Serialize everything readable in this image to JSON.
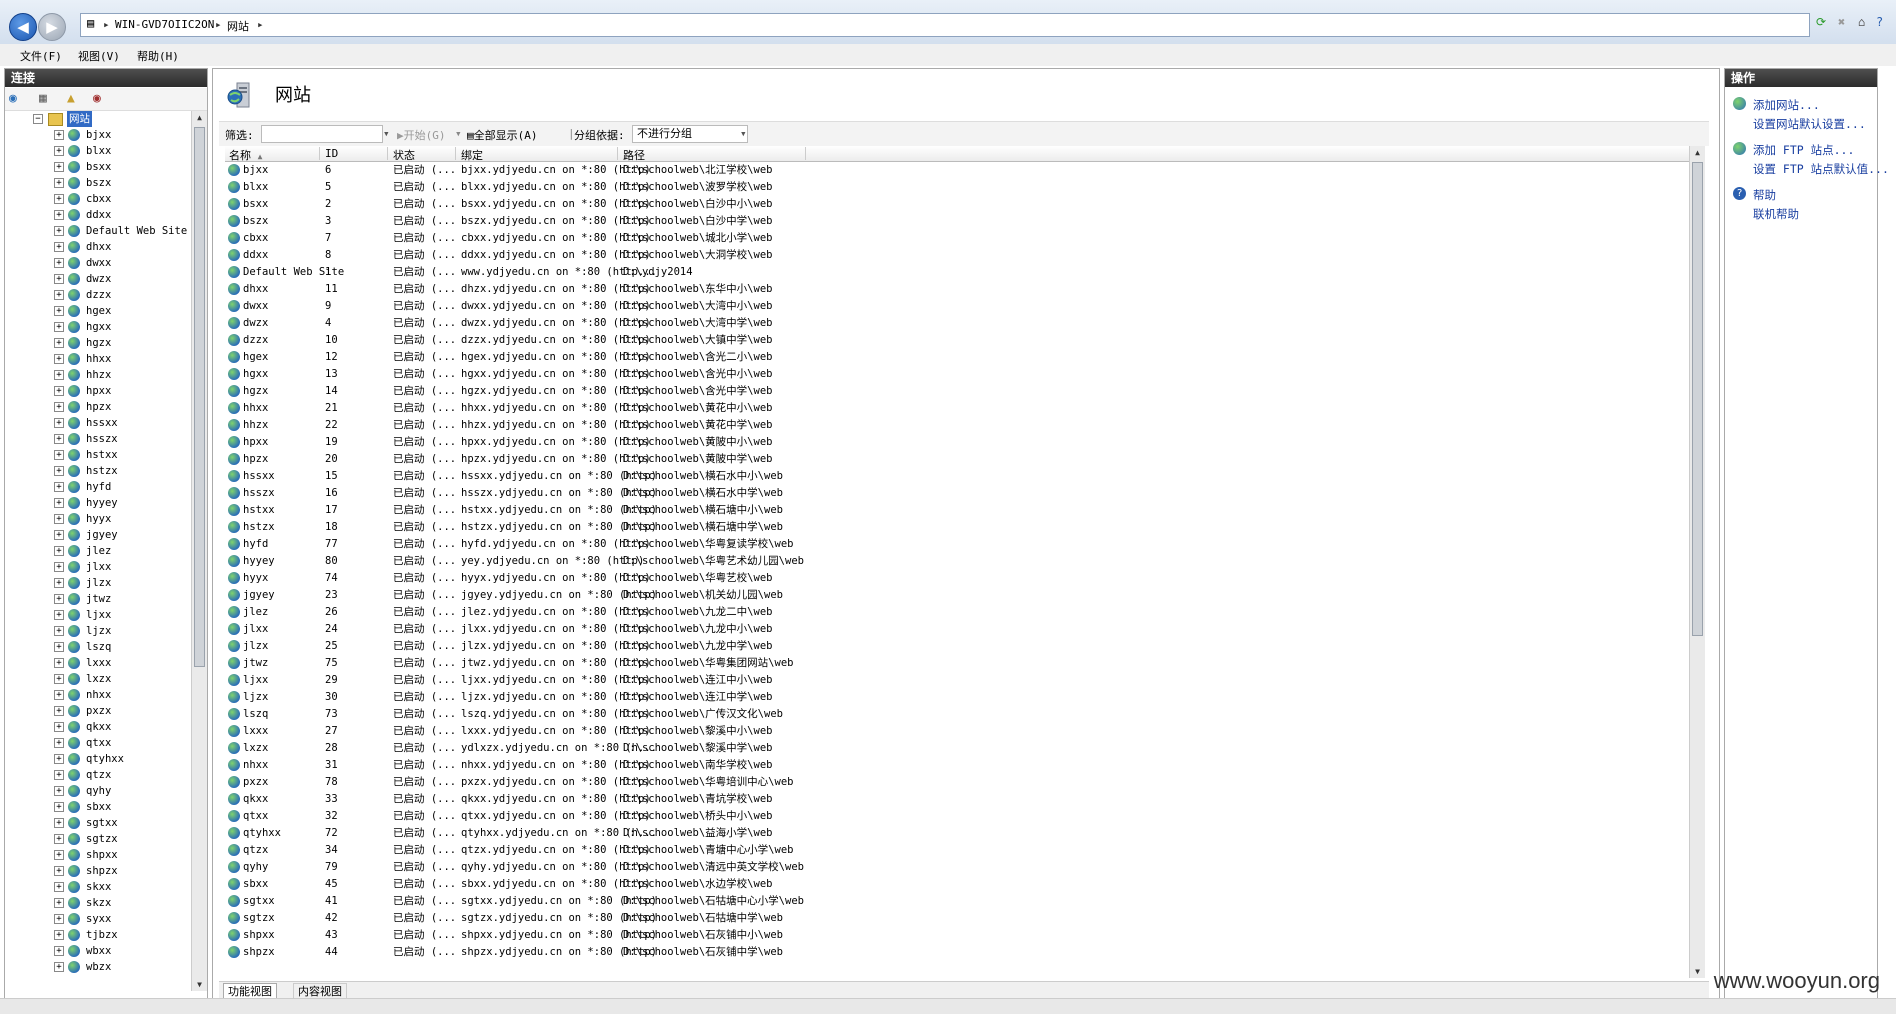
{
  "address": {
    "server": "WIN-GVD7OIIC2ON",
    "page": "网站"
  },
  "menu": [
    "文件(F)",
    "视图(V)",
    "帮助(H)"
  ],
  "connections": {
    "title": "连接",
    "root": "网站",
    "sites": [
      "bjxx",
      "blxx",
      "bsxx",
      "bszx",
      "cbxx",
      "ddxx",
      "Default Web Site",
      "dhxx",
      "dwxx",
      "dwzx",
      "dzzx",
      "hgex",
      "hgxx",
      "hgzx",
      "hhxx",
      "hhzx",
      "hpxx",
      "hpzx",
      "hssxx",
      "hsszx",
      "hstxx",
      "hstzx",
      "hyfd",
      "hyyey",
      "hyyx",
      "jgyey",
      "jlez",
      "jlxx",
      "jlzx",
      "jtwz",
      "ljxx",
      "ljzx",
      "lszq",
      "lxxx",
      "lxzx",
      "nhxx",
      "pxzx",
      "qkxx",
      "qtxx",
      "qtyhxx",
      "qtzx",
      "qyhy",
      "sbxx",
      "sgtxx",
      "sgtzx",
      "shpxx",
      "shpzx",
      "skxx",
      "skzx",
      "syxx",
      "tjbzx",
      "wbxx",
      "wbzx"
    ]
  },
  "main": {
    "title": "网站",
    "filter_label": "筛选:",
    "start_button": "开始(G)",
    "show_all_button": "全部显示(A)",
    "group_label": "分组依据:",
    "group_value": "不进行分组",
    "columns": [
      "名称",
      "ID",
      "状态",
      "绑定",
      "路径"
    ],
    "rows": [
      [
        "bjxx",
        "6",
        "已启动 (...",
        "bjxx.ydjyedu.cn on *:80 (http)",
        "D:\\schoolweb\\北江学校\\web"
      ],
      [
        "blxx",
        "5",
        "已启动 (...",
        "blxx.ydjyedu.cn on *:80 (http)",
        "D:\\schoolweb\\波罗学校\\web"
      ],
      [
        "bsxx",
        "2",
        "已启动 (...",
        "bsxx.ydjyedu.cn on *:80 (http)",
        "D:\\schoolweb\\白沙中小\\web"
      ],
      [
        "bszx",
        "3",
        "已启动 (...",
        "bszx.ydjyedu.cn on *:80 (http)",
        "D:\\schoolweb\\白沙中学\\web"
      ],
      [
        "cbxx",
        "7",
        "已启动 (...",
        "cbxx.ydjyedu.cn on *:80 (http)",
        "D:\\schoolweb\\城北小学\\web"
      ],
      [
        "ddxx",
        "8",
        "已启动 (...",
        "ddxx.ydjyedu.cn on *:80 (http)",
        "D:\\schoolweb\\大洞学校\\web"
      ],
      [
        "Default Web Site",
        "1",
        "已启动 (...",
        "www.ydjyedu.cn on *:80 (http...",
        "D:\\ydjy2014"
      ],
      [
        "dhxx",
        "11",
        "已启动 (...",
        "dhzx.ydjyedu.cn on *:80 (http)",
        "D:\\schoolweb\\东华中小\\web"
      ],
      [
        "dwxx",
        "9",
        "已启动 (...",
        "dwxx.ydjyedu.cn on *:80 (http)",
        "D:\\schoolweb\\大湾中小\\web"
      ],
      [
        "dwzx",
        "4",
        "已启动 (...",
        "dwzx.ydjyedu.cn on *:80 (http)",
        "D:\\schoolweb\\大湾中学\\web"
      ],
      [
        "dzzx",
        "10",
        "已启动 (...",
        "dzzx.ydjyedu.cn on *:80 (http)",
        "D:\\schoolweb\\大镇中学\\web"
      ],
      [
        "hgex",
        "12",
        "已启动 (...",
        "hgex.ydjyedu.cn on *:80 (http)",
        "D:\\schoolweb\\含光二小\\web"
      ],
      [
        "hgxx",
        "13",
        "已启动 (...",
        "hgxx.ydjyedu.cn on *:80 (http)",
        "D:\\schoolweb\\含光中小\\web"
      ],
      [
        "hgzx",
        "14",
        "已启动 (...",
        "hgzx.ydjyedu.cn on *:80 (http)",
        "D:\\schoolweb\\含光中学\\web"
      ],
      [
        "hhxx",
        "21",
        "已启动 (...",
        "hhxx.ydjyedu.cn on *:80 (http)",
        "D:\\schoolweb\\黄花中小\\web"
      ],
      [
        "hhzx",
        "22",
        "已启动 (...",
        "hhzx.ydjyedu.cn on *:80 (http)",
        "D:\\schoolweb\\黄花中学\\web"
      ],
      [
        "hpxx",
        "19",
        "已启动 (...",
        "hpxx.ydjyedu.cn on *:80 (http)",
        "D:\\schoolweb\\黄陂中小\\web"
      ],
      [
        "hpzx",
        "20",
        "已启动 (...",
        "hpzx.ydjyedu.cn on *:80 (http)",
        "D:\\schoolweb\\黄陂中学\\web"
      ],
      [
        "hssxx",
        "15",
        "已启动 (...",
        "hssxx.ydjyedu.cn on *:80 (http)",
        "D:\\schoolweb\\横石水中小\\web"
      ],
      [
        "hsszx",
        "16",
        "已启动 (...",
        "hsszx.ydjyedu.cn on *:80 (http)",
        "D:\\schoolweb\\横石水中学\\web"
      ],
      [
        "hstxx",
        "17",
        "已启动 (...",
        "hstxx.ydjyedu.cn on *:80 (http)",
        "D:\\schoolweb\\横石塘中小\\web"
      ],
      [
        "hstzx",
        "18",
        "已启动 (...",
        "hstzx.ydjyedu.cn on *:80 (http)",
        "D:\\schoolweb\\横石塘中学\\web"
      ],
      [
        "hyfd",
        "77",
        "已启动 (...",
        "hyfd.ydjyedu.cn on *:80 (http)",
        "D:\\schoolweb\\华粤复读学校\\web"
      ],
      [
        "hyyey",
        "80",
        "已启动 (...",
        "yey.ydjyedu.cn on *:80 (http)",
        "D:\\schoolweb\\华粤艺术幼儿园\\web"
      ],
      [
        "hyyx",
        "74",
        "已启动 (...",
        "hyyx.ydjyedu.cn on *:80 (http)",
        "D:\\schoolweb\\华粤艺校\\web"
      ],
      [
        "jgyey",
        "23",
        "已启动 (...",
        "jgyey.ydjyedu.cn on *:80 (http)",
        "D:\\schoolweb\\机关幼儿园\\web"
      ],
      [
        "jlez",
        "26",
        "已启动 (...",
        "jlez.ydjyedu.cn on *:80 (http)",
        "D:\\schoolweb\\九龙二中\\web"
      ],
      [
        "jlxx",
        "24",
        "已启动 (...",
        "jlxx.ydjyedu.cn on *:80 (http)",
        "D:\\schoolweb\\九龙中小\\web"
      ],
      [
        "jlzx",
        "25",
        "已启动 (...",
        "jlzx.ydjyedu.cn on *:80 (http)",
        "D:\\schoolweb\\九龙中学\\web"
      ],
      [
        "jtwz",
        "75",
        "已启动 (...",
        "jtwz.ydjyedu.cn on *:80 (http)",
        "D:\\schoolweb\\华粤集团网站\\web"
      ],
      [
        "ljxx",
        "29",
        "已启动 (...",
        "ljxx.ydjyedu.cn on *:80 (http)",
        "D:\\schoolweb\\连江中小\\web"
      ],
      [
        "ljzx",
        "30",
        "已启动 (...",
        "ljzx.ydjyedu.cn on *:80 (http)",
        "D:\\schoolweb\\连江中学\\web"
      ],
      [
        "lszq",
        "73",
        "已启动 (...",
        "lszq.ydjyedu.cn on *:80 (http)",
        "D:\\schoolweb\\广传汉文化\\web"
      ],
      [
        "lxxx",
        "27",
        "已启动 (...",
        "lxxx.ydjyedu.cn on *:80 (http)",
        "D:\\schoolweb\\黎溪中小\\web"
      ],
      [
        "lxzx",
        "28",
        "已启动 (...",
        "ydlxzx.ydjyedu.cn on *:80 (h...",
        "D:\\schoolweb\\黎溪中学\\web"
      ],
      [
        "nhxx",
        "31",
        "已启动 (...",
        "nhxx.ydjyedu.cn on *:80 (http)",
        "D:\\schoolweb\\南华学校\\web"
      ],
      [
        "pxzx",
        "78",
        "已启动 (...",
        "pxzx.ydjyedu.cn on *:80 (http)",
        "D:\\schoolweb\\华粤培训中心\\web"
      ],
      [
        "qkxx",
        "33",
        "已启动 (...",
        "qkxx.ydjyedu.cn on *:80 (http)",
        "D:\\schoolweb\\青坑学校\\web"
      ],
      [
        "qtxx",
        "32",
        "已启动 (...",
        "qtxx.ydjyedu.cn on *:80 (http)",
        "D:\\schoolweb\\桥头中小\\web"
      ],
      [
        "qtyhxx",
        "72",
        "已启动 (...",
        "qtyhxx.ydjyedu.cn on *:80 (h...",
        "D:\\schoolweb\\益海小学\\web"
      ],
      [
        "qtzx",
        "34",
        "已启动 (...",
        "qtzx.ydjyedu.cn on *:80 (http)",
        "D:\\schoolweb\\青塘中心小学\\web"
      ],
      [
        "qyhy",
        "79",
        "已启动 (...",
        "qyhy.ydjyedu.cn on *:80 (http)",
        "D:\\schoolweb\\清远中英文学校\\web"
      ],
      [
        "sbxx",
        "45",
        "已启动 (...",
        "sbxx.ydjyedu.cn on *:80 (http)",
        "D:\\schoolweb\\水边学校\\web"
      ],
      [
        "sgtxx",
        "41",
        "已启动 (...",
        "sgtxx.ydjyedu.cn on *:80 (http)",
        "D:\\schoolweb\\石牯塘中心小学\\web"
      ],
      [
        "sgtzx",
        "42",
        "已启动 (...",
        "sgtzx.ydjyedu.cn on *:80 (http)",
        "D:\\schoolweb\\石牯塘中学\\web"
      ],
      [
        "shpxx",
        "43",
        "已启动 (...",
        "shpxx.ydjyedu.cn on *:80 (http)",
        "D:\\schoolweb\\石灰铺中小\\web"
      ],
      [
        "shpzx",
        "44",
        "已启动 (...",
        "shpzx.ydjyedu.cn on *:80 (http)",
        "D:\\schoolweb\\石灰铺中学\\web"
      ]
    ],
    "tab_features": "功能视图",
    "tab_content": "内容视图"
  },
  "actions": {
    "title": "操作",
    "items": [
      "添加网站...",
      "设置网站默认设置...",
      "添加 FTP 站点...",
      "设置 FTP 站点默认值...",
      "帮助",
      "联机帮助"
    ]
  },
  "watermark": "www.wooyun.org",
  "colors": {
    "accent": "#1a3fa0",
    "selection": "#316ac5",
    "pane_title": "#3a3a3a"
  }
}
